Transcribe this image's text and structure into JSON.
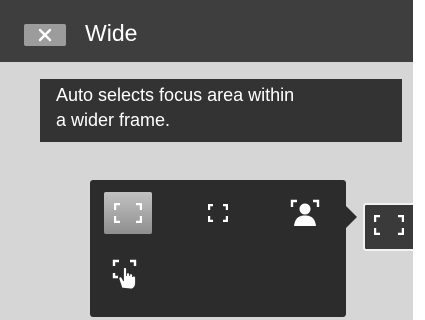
{
  "header": {
    "close_icon": "close-x-icon",
    "title": "Wide"
  },
  "hint": {
    "lines": [
      "Auto selects focus area within",
      "a wider frame."
    ]
  },
  "focus_menu": {
    "options": [
      {
        "icon": "wide-focus-brackets-icon",
        "selected": true
      },
      {
        "icon": "spot-focus-brackets-icon",
        "selected": false
      },
      {
        "icon": "face-detect-icon",
        "selected": false
      },
      {
        "icon": "touch-focus-icon",
        "selected": false
      }
    ],
    "current_icon": "wide-focus-brackets-icon"
  },
  "colors": {
    "title_bar": "#3e3e3e",
    "screen_bg": "#d6d6d6",
    "hint_bg": "#333333",
    "panel_bg": "#2c2c2c",
    "selected_highlight": "#a8a8a8",
    "icon_white": "#ffffff"
  }
}
